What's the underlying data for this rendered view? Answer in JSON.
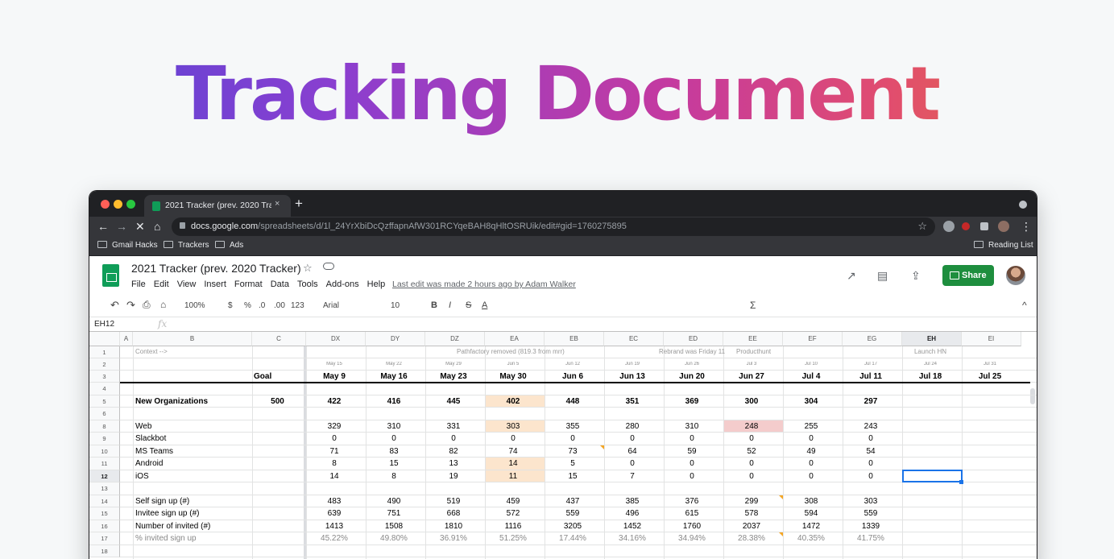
{
  "hero": {
    "title": "Tracking Document"
  },
  "browser": {
    "tab_title": "2021 Tracker (prev. 2020 Track",
    "tab_close": "×",
    "new_tab": "+",
    "url_host": "docs.google.com",
    "url_path": "/spreadsheets/d/1l_24YrXbiDcQzffapnAfW301RCYqeBAH8qHltOSRUik/edit#gid=1760275895",
    "nav": {
      "back": "←",
      "forward": "→",
      "reload": "✕",
      "home": "⌂",
      "star": "☆",
      "menu": "⋮"
    },
    "bookmarks": [
      "Gmail Hacks",
      "Trackers",
      "Ads"
    ],
    "reading_list": "Reading List"
  },
  "sheets": {
    "title": "2021 Tracker (prev. 2020 Tracker)",
    "star": "☆",
    "menus": [
      "File",
      "Edit",
      "View",
      "Insert",
      "Format",
      "Data",
      "Tools",
      "Add-ons",
      "Help"
    ],
    "last_edit": "Last edit was made 2 hours ago by Adam Walker",
    "share_label": "Share",
    "icons": {
      "trend": "↗",
      "comment": "▤",
      "present": "⇪"
    },
    "toolbar": {
      "undo": "↶",
      "redo": "↷",
      "print": "⎙",
      "paint": "⌂",
      "zoom": "100%",
      "currency": "$",
      "percent": "%",
      "dec_less": ".0",
      "dec_more": ".00",
      "more_formats": "123",
      "font": "Arial",
      "size": "10",
      "bold": "B",
      "italic": "I",
      "strike": "S",
      "textcolor": "A",
      "functions": "Σ",
      "collapse": "^"
    },
    "namebox": "EH12",
    "fx": "fx"
  },
  "grid": {
    "columns": [
      "A",
      "B",
      "C",
      "DX",
      "DY",
      "DZ",
      "EA",
      "EB",
      "EC",
      "ED",
      "EE",
      "EF",
      "EG",
      "EH",
      "EI"
    ],
    "rows": [
      "1",
      "2",
      "3",
      "4",
      "5",
      "6",
      "8",
      "9",
      "10",
      "11",
      "12",
      "13",
      "14",
      "15",
      "16",
      "17",
      "18"
    ],
    "context": "Context -->",
    "row1_notes": [
      "Pathfactory removed (819.3 from mrr)",
      "Rebrand was Friday 11",
      "Producthunt",
      "Launch HN"
    ],
    "row2_dates": [
      "May 15",
      "May 22",
      "May 29",
      "Jun 5",
      "Jun 12",
      "Jun 19",
      "Jun 26",
      "Jul 3",
      "Jul 10",
      "Jul 17",
      "Jul 24",
      "Jul 31"
    ],
    "goal_label": "Goal",
    "weeks": [
      "May 9",
      "May 16",
      "May 23",
      "May 30",
      "Jun 6",
      "Jun 13",
      "Jun 20",
      "Jun 27",
      "Jul 4",
      "Jul 11",
      "Jul 18",
      "Jul 25"
    ],
    "data_rows": [
      {
        "label": "New Organizations",
        "goal": "500",
        "bold": true,
        "values": [
          "422",
          "416",
          "445",
          "402",
          "448",
          "351",
          "369",
          "300",
          "304",
          "297"
        ]
      },
      {
        "label": "Web",
        "values": [
          "329",
          "310",
          "331",
          "303",
          "355",
          "280",
          "310",
          "248",
          "255",
          "243"
        ]
      },
      {
        "label": "Slackbot",
        "values": [
          "0",
          "0",
          "0",
          "0",
          "0",
          "0",
          "0",
          "0",
          "0",
          "0"
        ]
      },
      {
        "label": "MS Teams",
        "values": [
          "71",
          "83",
          "82",
          "74",
          "73",
          "64",
          "59",
          "52",
          "49",
          "54"
        ]
      },
      {
        "label": "Android",
        "values": [
          "8",
          "15",
          "13",
          "14",
          "5",
          "0",
          "0",
          "0",
          "0",
          "0"
        ]
      },
      {
        "label": "iOS",
        "values": [
          "14",
          "8",
          "19",
          "11",
          "15",
          "7",
          "0",
          "0",
          "0",
          "0"
        ]
      },
      {
        "label": "Self sign up (#)",
        "values": [
          "483",
          "490",
          "519",
          "459",
          "437",
          "385",
          "376",
          "299",
          "308",
          "303"
        ]
      },
      {
        "label": "Invitee sign up (#)",
        "values": [
          "639",
          "751",
          "668",
          "572",
          "559",
          "496",
          "615",
          "578",
          "594",
          "559"
        ]
      },
      {
        "label": "Number of invited (#)",
        "values": [
          "1413",
          "1508",
          "1810",
          "1116",
          "3205",
          "1452",
          "1760",
          "2037",
          "1472",
          "1339"
        ]
      },
      {
        "label": "% invited sign up",
        "muted": true,
        "values": [
          "45.22%",
          "49.80%",
          "36.91%",
          "51.25%",
          "17.44%",
          "34.16%",
          "34.94%",
          "28.38%",
          "40.35%",
          "41.75%"
        ]
      }
    ]
  },
  "colors": {
    "orange_highlight": "#fce5cd",
    "red_highlight": "#f4cccc",
    "selection": "#1a73e8",
    "share_green": "#1e8e3e"
  }
}
